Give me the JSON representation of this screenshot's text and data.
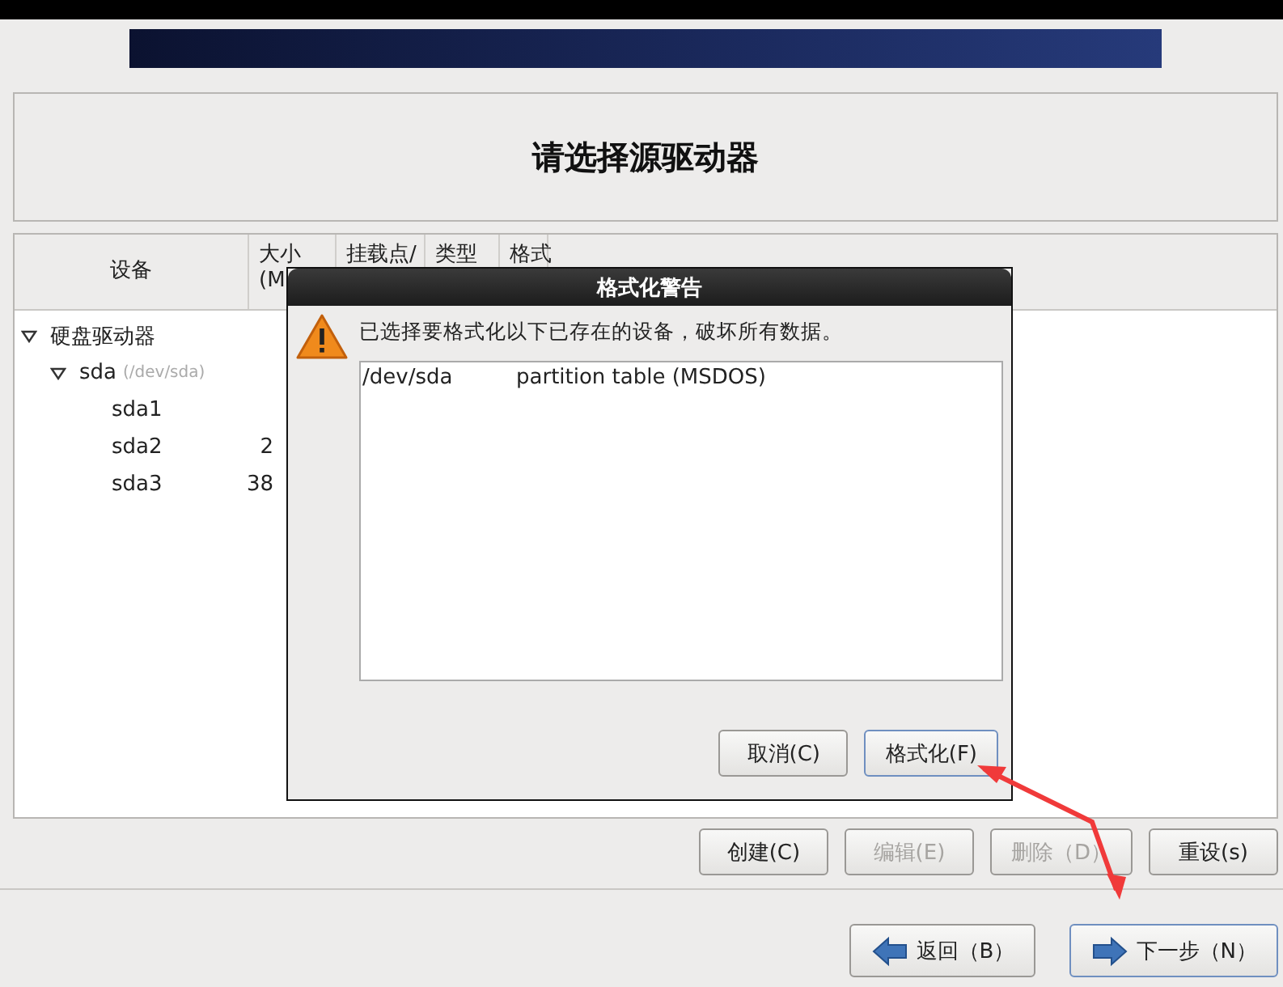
{
  "header": {
    "title": "请选择源驱动器"
  },
  "table": {
    "columns": [
      {
        "label": "设备"
      },
      {
        "label": "大小\n(M"
      },
      {
        "label": "挂载点/"
      },
      {
        "label": "类型"
      },
      {
        "label": "格式"
      }
    ],
    "rows": [
      {
        "name": "硬盘驱动器",
        "expanded": true,
        "children": [
          {
            "name": "sda",
            "detail": "(/dev/sda)",
            "expanded": true,
            "children": [
              {
                "name": "sda1"
              },
              {
                "name": "sda2",
                "size": "2"
              },
              {
                "name": "sda3",
                "size": "38"
              }
            ]
          }
        ]
      }
    ]
  },
  "dialog": {
    "title": "格式化警告",
    "message": "已选择要格式化以下已存在的设备，破坏所有数据。",
    "devices": [
      {
        "device": "/dev/sda",
        "description": "partition table (MSDOS)"
      }
    ],
    "buttons": [
      {
        "label": "取消(C)",
        "focused": false
      },
      {
        "label": "格式化(F)",
        "focused": true
      }
    ]
  },
  "actions": [
    {
      "label": "创建(C)",
      "disabled": false
    },
    {
      "label": "编辑(E)",
      "disabled": true
    },
    {
      "label": "删除（D）",
      "disabled": true
    },
    {
      "label": "重设(s)",
      "disabled": false
    }
  ],
  "navigation": [
    {
      "label": "返回（B）",
      "kind": "back"
    },
    {
      "label": "下一步（N）",
      "kind": "next"
    }
  ]
}
